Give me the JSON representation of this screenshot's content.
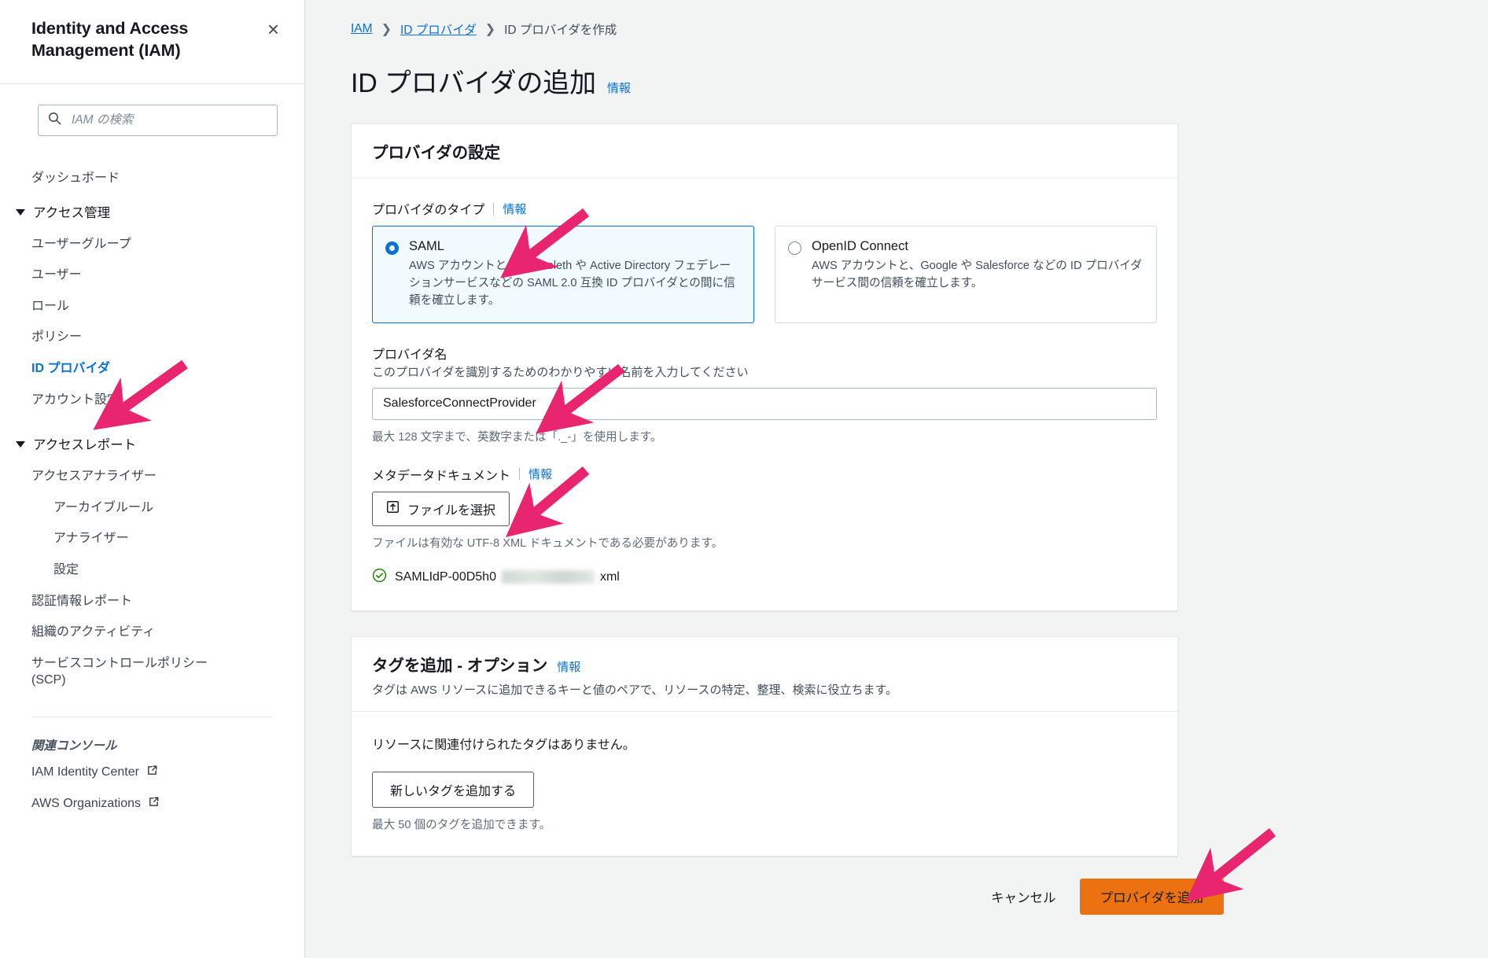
{
  "sidebar": {
    "title": "Identity and Access Management (IAM)",
    "close_label": "×",
    "search": {
      "placeholder": "IAM の検索",
      "value": ""
    },
    "nav": [
      {
        "label": "ダッシュボード",
        "level": "l1",
        "type": "item",
        "active": false
      },
      {
        "label": "アクセス管理",
        "level": "l1",
        "type": "group"
      },
      {
        "label": "ユーザーグループ",
        "level": "l2",
        "type": "item",
        "active": false
      },
      {
        "label": "ユーザー",
        "level": "l2",
        "type": "item",
        "active": false
      },
      {
        "label": "ロール",
        "level": "l2",
        "type": "item",
        "active": false
      },
      {
        "label": "ポリシー",
        "level": "l2",
        "type": "item",
        "active": false
      },
      {
        "label": "ID プロバイダ",
        "level": "l2",
        "type": "item",
        "active": true
      },
      {
        "label": "アカウント設定",
        "level": "l2",
        "type": "item",
        "active": false
      },
      {
        "label": "アクセスレポート",
        "level": "l1",
        "type": "group"
      },
      {
        "label": "アクセスアナライザー",
        "level": "l2",
        "type": "item",
        "active": false
      },
      {
        "label": "アーカイブルール",
        "level": "l3",
        "type": "item",
        "active": false
      },
      {
        "label": "アナライザー",
        "level": "l3",
        "type": "item",
        "active": false
      },
      {
        "label": "設定",
        "level": "l3",
        "type": "item",
        "active": false
      },
      {
        "label": "認証情報レポート",
        "level": "l2",
        "type": "item",
        "active": false
      },
      {
        "label": "組織のアクティビティ",
        "level": "l2",
        "type": "item",
        "active": false
      },
      {
        "label": "サービスコントロールポリシー (SCP)",
        "level": "l2",
        "type": "item",
        "active": false
      }
    ],
    "related_title": "関連コンソール",
    "related": [
      {
        "label": "IAM Identity Center",
        "icon": "external-link-icon"
      },
      {
        "label": "AWS Organizations",
        "icon": "external-link-icon"
      }
    ]
  },
  "breadcrumb": {
    "items": [
      "IAM",
      "ID プロバイダ",
      "ID プロバイダを作成"
    ]
  },
  "page": {
    "title": "ID プロバイダの追加",
    "info_label": "情報"
  },
  "provider_panel": {
    "heading": "プロバイダの設定",
    "type_label": "プロバイダのタイプ",
    "type_info": "情報",
    "options": [
      {
        "id": "saml",
        "title": "SAML",
        "selected": true,
        "desc": "AWS アカウントと、Shibboleth や Active Directory フェデレーションサービスなどの SAML 2.0 互換 ID プロバイダとの間に信頼を確立します。"
      },
      {
        "id": "oidc",
        "title": "OpenID Connect",
        "selected": false,
        "desc": "AWS アカウントと、Google や Salesforce などの ID プロバイダサービス間の信頼を確立します。"
      }
    ],
    "name_label": "プロバイダ名",
    "name_desc": "このプロバイダを識別するためのわかりやすい名前を入力してください",
    "name_value": "SalesforceConnectProvider",
    "name_placeholder": "",
    "name_hint": "最大 128 文字まで、英数字または「._-」を使用します。",
    "metadata_label": "メタデータドキュメント",
    "metadata_info": "情報",
    "choose_file_label": "ファイルを選択",
    "metadata_hint": "ファイルは有効な UTF-8 XML ドキュメントである必要があります。",
    "uploaded_file_prefix": "SAMLIdP-00D5h0",
    "uploaded_file_suffix": "xml"
  },
  "tags_panel": {
    "heading": "タグを追加 - オプション",
    "info_label": "情報",
    "desc": "タグは AWS リソースに追加できるキーと値のペアで、リソースの特定、整理、検索に役立ちます。",
    "empty_text": "リソースに関連付けられたタグはありません。",
    "add_tag_label": "新しいタグを追加する",
    "limit_hint": "最大 50 個のタグを追加できます。"
  },
  "footer": {
    "cancel_label": "キャンセル",
    "submit_label": "プロバイダを追加"
  },
  "colors": {
    "accent_blue": "#0972d3",
    "primary_orange": "#ec7211",
    "annotation_pink": "#e8256e",
    "success_green": "#1d8102",
    "selected_card_bg": "#f1faff"
  }
}
